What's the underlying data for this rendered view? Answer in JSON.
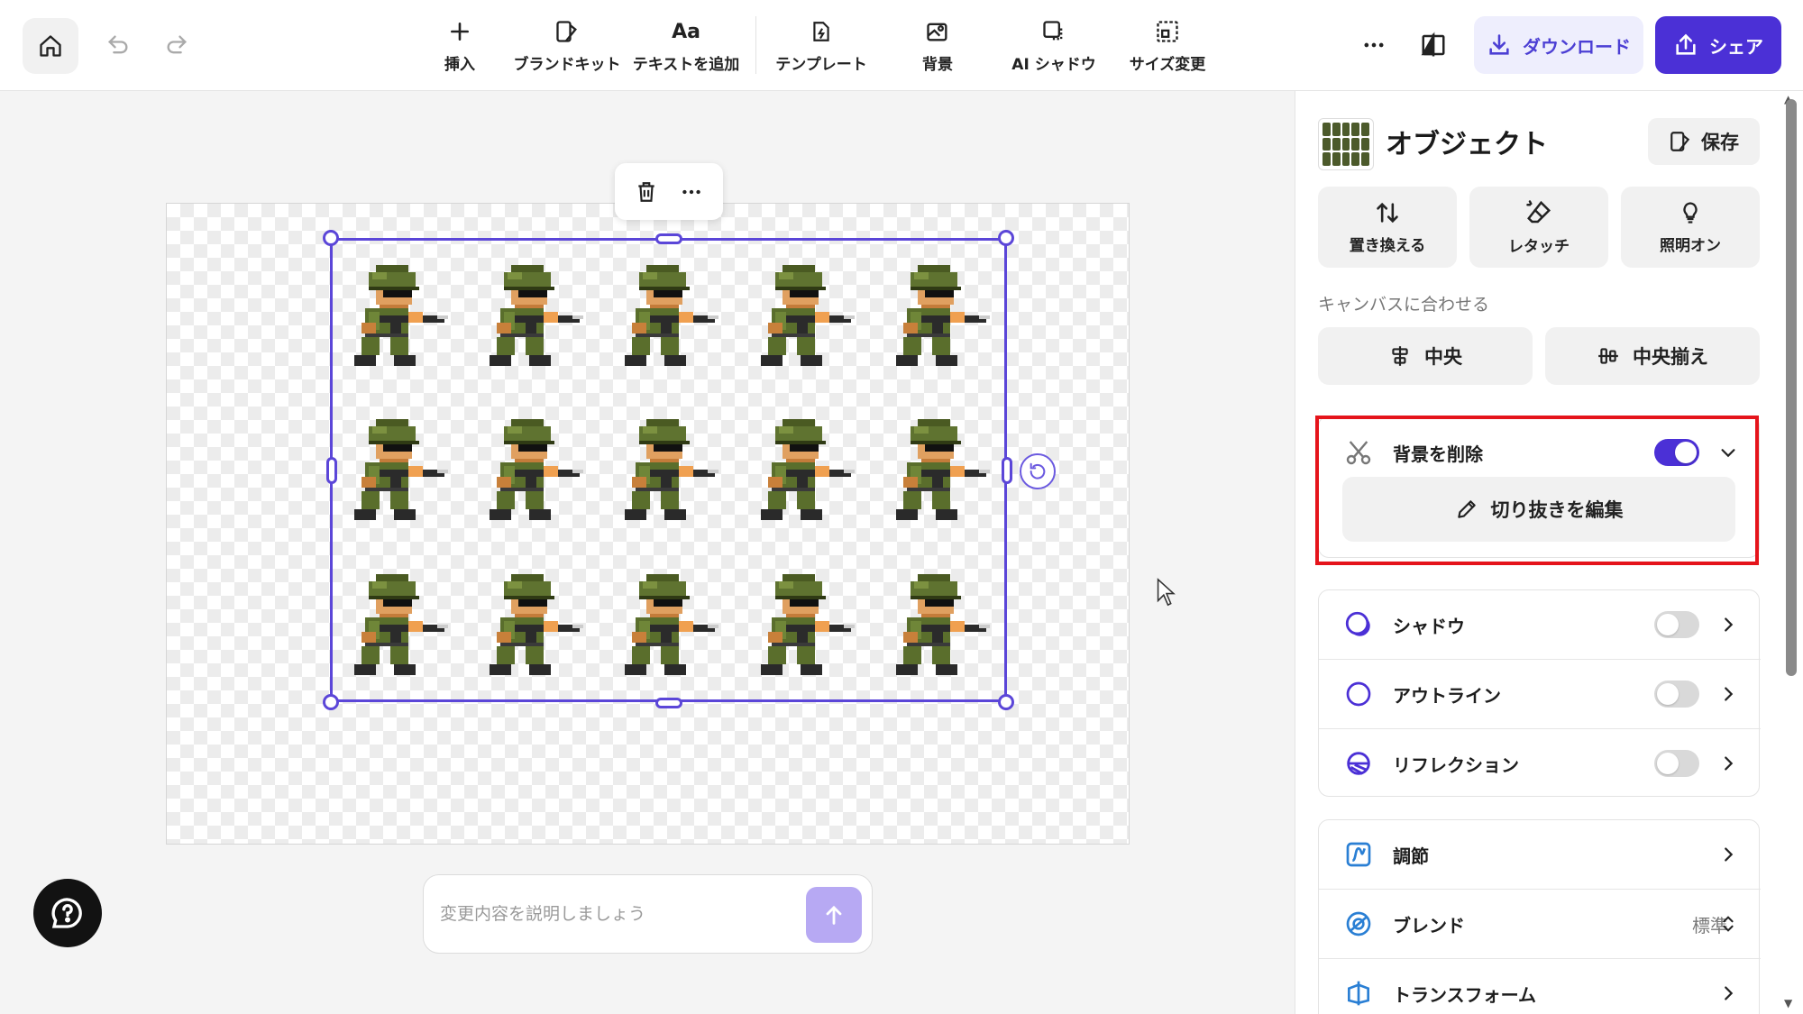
{
  "toolbar": {
    "tools": [
      {
        "label": "挿入",
        "icon": "plus-icon"
      },
      {
        "label": "ブランドキット",
        "icon": "brand-kit-icon"
      },
      {
        "label": "テキストを追加",
        "icon": "text-icon",
        "glyph": "Aa"
      },
      {
        "label": "テンプレート",
        "icon": "template-icon"
      },
      {
        "label": "背景",
        "icon": "background-icon"
      },
      {
        "label": "AI シャドウ",
        "icon": "ai-shadow-icon"
      },
      {
        "label": "サイズ変更",
        "icon": "resize-icon"
      }
    ],
    "download_label": "ダウンロード",
    "share_label": "シェア"
  },
  "canvas": {
    "sprite_rows": 3,
    "sprite_cols": 5,
    "prompt_placeholder": "変更内容を説明しましょう"
  },
  "panel": {
    "title": "オブジェクト",
    "save_label": "保存",
    "actions": [
      {
        "label": "置き換える",
        "icon": "replace-icon"
      },
      {
        "label": "レタッチ",
        "icon": "retouch-eraser-icon"
      },
      {
        "label": "照明オン",
        "icon": "lightbulb-icon"
      }
    ],
    "fit_label": "キャンバスに合わせる",
    "fit_buttons": [
      {
        "label": "中央",
        "icon": "align-center-icon"
      },
      {
        "label": "中央揃え",
        "icon": "align-middle-icon"
      }
    ],
    "remove_bg": {
      "label": "背景を削除",
      "enabled": true,
      "edit_cutout_label": "切り抜きを編集"
    },
    "effects": [
      {
        "label": "シャドウ",
        "enabled": false,
        "icon": "shadow-icon"
      },
      {
        "label": "アウトライン",
        "enabled": false,
        "icon": "outline-icon"
      },
      {
        "label": "リフレクション",
        "enabled": false,
        "icon": "reflection-icon"
      }
    ],
    "adjust": [
      {
        "label": "調節",
        "icon": "adjust-curve-icon"
      },
      {
        "label": "ブレンド",
        "icon": "blend-icon",
        "value": "標準"
      },
      {
        "label": "トランスフォーム",
        "icon": "transform-icon"
      }
    ]
  },
  "colors": {
    "accent": "#4b30d6",
    "highlight": "#e5141b",
    "selection": "#5b46d8"
  }
}
